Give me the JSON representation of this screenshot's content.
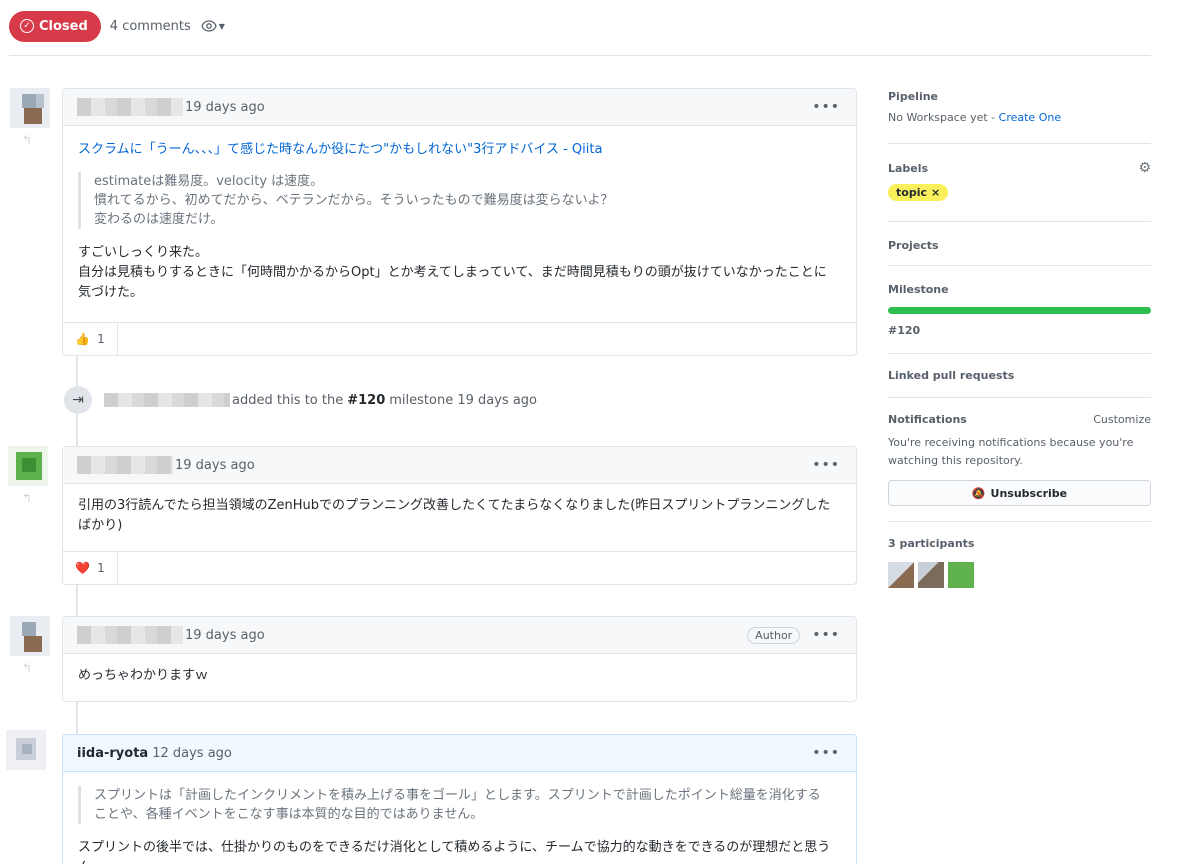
{
  "header": {
    "state_label": "Closed",
    "comment_count": "4 comments",
    "watch_icon": "eye-icon"
  },
  "comments": [
    {
      "time": "19 days ago",
      "link": "スクラムに「うーん、、、」て感じた時なんか役にたつ\"かもしれない\"3行アドバイス - Qiita",
      "quote": [
        "estimateは難易度。velocity は速度。",
        "慣れてるから、初めてだから、ベテランだから。そういったもので難易度は変らないよ？",
        "変わるのは速度だけ。"
      ],
      "body": [
        "すごいしっくり来た。",
        "自分は見積もりするときに「何時間かかるからOpt」とか考えてしまっていて、まだ時間見積もりの頭が抜けていなかったことに",
        "気づけた。"
      ],
      "reaction_emoji": "👍",
      "reaction_count": "1"
    },
    {
      "time": "19 days ago",
      "body": [
        "引用の3行読んでたら担当領域のZenHubでのプランニング改善したくてたまらなくなりました(昨日スプリントプランニングした",
        "ばかり)"
      ],
      "reaction_emoji": "❤️",
      "reaction_count": "1"
    },
    {
      "time": "19 days ago",
      "author_tag": "Author",
      "body": [
        "めっちゃわかりますｗ"
      ]
    },
    {
      "author": "iida-ryota",
      "time": "12 days ago",
      "quote": [
        "スプリントは「計画したインクリメントを積み上げる事をゴール」とします。スプリントで計画したポイント総量を消化する",
        "ことや、各種イベントをこなす事は本質的な目的ではありません。"
      ],
      "body": [
        "スプリントの後半では、仕掛かりのものをできるだけ消化として積めるように、チームで協力的な動きをできるのが理想だと思うん"
      ]
    }
  ],
  "event": {
    "text_before": "added this to the",
    "milestone": "#120",
    "text_after": "milestone 19 days ago"
  },
  "sidebar": {
    "pipeline_title": "Pipeline",
    "pipeline_text": "No Workspace yet - ",
    "pipeline_link": "Create One",
    "labels_title": "Labels",
    "label_name": "topic",
    "label_remove": "×",
    "label_color": "#f9f05c",
    "projects_title": "Projects",
    "milestone_title": "Milestone",
    "milestone_progress": 1.0,
    "milestone_name": "#120",
    "linked_title": "Linked pull requests",
    "notifications_title": "Notifications",
    "customize": "Customize",
    "notifications_text": [
      "You're receiving notifications because you're",
      "watching this repository."
    ],
    "unsubscribe": "Unsubscribe",
    "participants_title": "3 participants"
  },
  "colors": {
    "closed": "#d73a49",
    "link": "#0366d6",
    "progress": "#2cbe4e"
  }
}
